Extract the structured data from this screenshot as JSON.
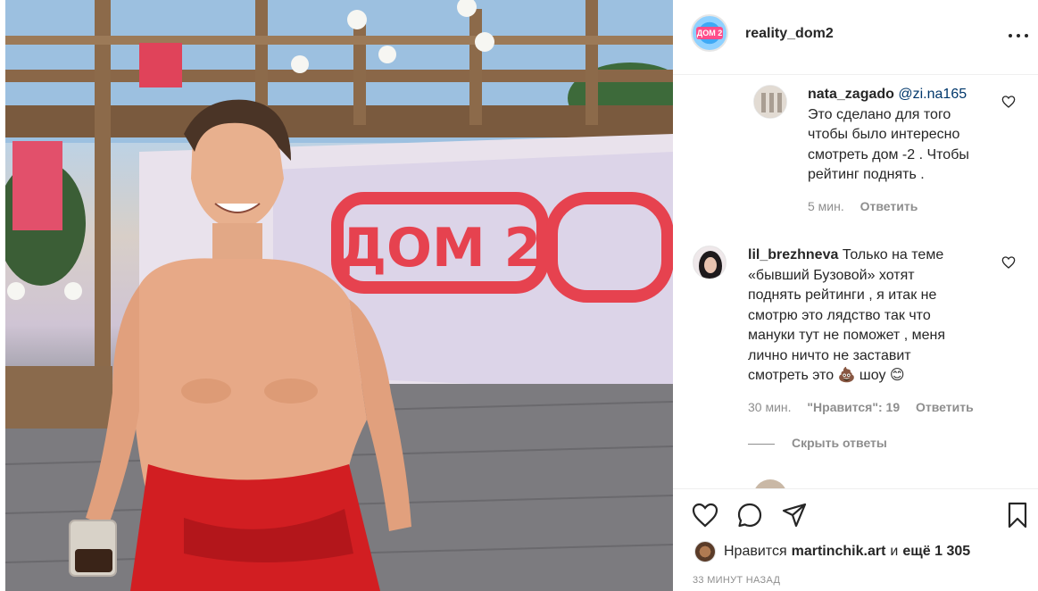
{
  "post": {
    "username": "reality_dom2",
    "avatar_logo_text": "ДОМ 2",
    "photo_sign_text": "ДОМ 2",
    "more_icon": "more-horizontal-icon"
  },
  "comments": [
    {
      "username": "nata_zagado",
      "mention": "@zi.na165",
      "lines": [
        "Это сделано для того",
        "чтобы было интересно",
        "смотреть дом -2 . Чтобы",
        "рейтинг поднять ."
      ],
      "time": "5 мин.",
      "reply_label": "Ответить"
    },
    {
      "username": "lil_brezhneva",
      "lines": [
        "Только на теме",
        "«бывший Бузовой» хотят",
        "поднять рейтинги , я итак не",
        "смотрю это лядство так что",
        "мануки тут не поможет , меня",
        "лично ничто не заставит",
        "смотреть это 💩 шоу 😊"
      ],
      "time": "30 мин.",
      "likes_label": "\"Нравится\": 19",
      "reply_label": "Ответить"
    }
  ],
  "hide_replies_label": "Скрыть ответы",
  "actions": {
    "like_icon": "heart-icon",
    "comment_icon": "comment-icon",
    "share_icon": "share-icon",
    "save_icon": "bookmark-icon"
  },
  "likes": {
    "prefix": "Нравится",
    "user": "martinchik.art",
    "conjunction": "и",
    "count_text": "ещё 1 305"
  },
  "timestamp": "33 МИНУТ НАЗАД"
}
